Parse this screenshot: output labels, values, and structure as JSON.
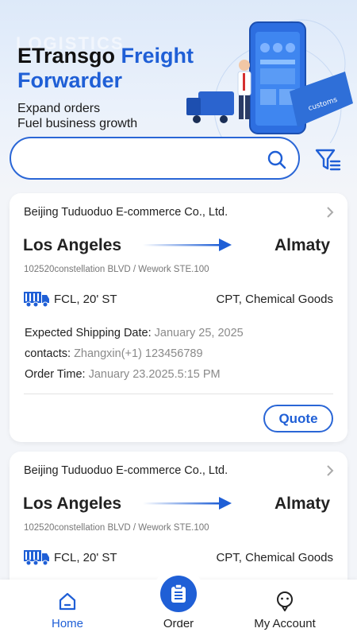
{
  "hero": {
    "bg_text": "LOGISTICS",
    "title_part1": "ETransgo ",
    "title_part2": "Freight",
    "title_line2": "Forwarder",
    "subtitle_line1": "Expand orders",
    "subtitle_line2": "Fuel business growth",
    "art_label": "customs"
  },
  "search": {
    "value": "",
    "placeholder": ""
  },
  "orders": [
    {
      "company": "Beijing Tuduoduo E-commerce Co., Ltd.",
      "from": "Los Angeles",
      "to": "Almaty",
      "address": "102520constellation BLVD   / Wework STE.100",
      "cargo_type": "FCL, 20' ST",
      "cargo_terms": "CPT, Chemical Goods",
      "shipping_label": "Expected Shipping Date: ",
      "shipping_value": "January 25, 2025",
      "contacts_label": "contacts: ",
      "contacts_value": "Zhangxin(+1) 123456789",
      "order_time_label": "Order Time: ",
      "order_time_value": "January 23.2025.5:15 PM",
      "quote_label": "Quote"
    },
    {
      "company": "Beijing Tuduoduo E-commerce Co., Ltd.",
      "from": "Los Angeles",
      "to": "Almaty",
      "address": "102520constellation BLVD   / Wework STE.100",
      "cargo_type": "FCL, 20' ST",
      "cargo_terms": "CPT, Chemical Goods"
    }
  ],
  "tabbar": {
    "home": "Home",
    "order": "Order",
    "account": "My Account",
    "active_color": "#1f5fd6"
  },
  "colors": {
    "accent": "#1f5fd6",
    "muted_text": "#8a8a8a"
  }
}
